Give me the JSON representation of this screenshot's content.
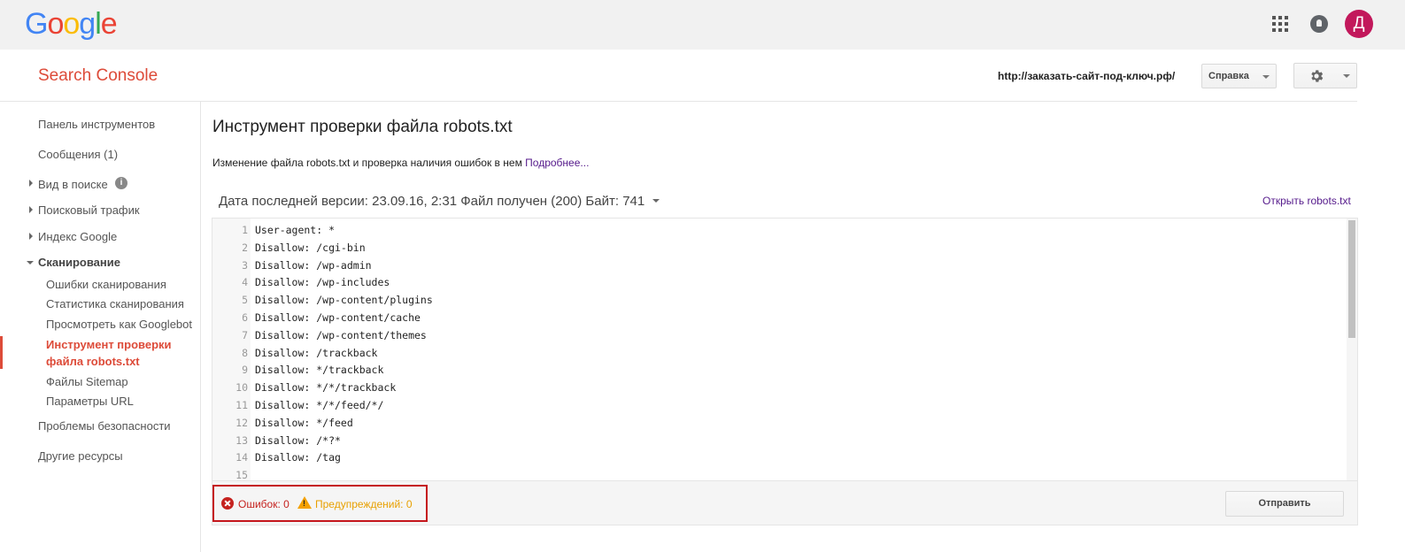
{
  "gbar": {
    "logo_letters": [
      "G",
      "o",
      "o",
      "g",
      "l",
      "e"
    ],
    "logo_colors": [
      "#4285f4",
      "#ea4335",
      "#fbbc05",
      "#4285f4",
      "#34a853",
      "#ea4335"
    ],
    "avatar_letter": "Д",
    "icons": [
      "apps-grid-icon",
      "notifications-bell-icon"
    ]
  },
  "header": {
    "app_title": "Search Console",
    "site_url": "http://заказать-сайт-под-ключ.рф/",
    "help_label": "Справка",
    "settings_icon": "gear-icon"
  },
  "sidebar": {
    "dashboard": "Панель инструментов",
    "messages": "Сообщения (1)",
    "search_appearance": "Вид в поиске",
    "search_traffic": "Поисковый трафик",
    "google_index": "Индекс Google",
    "crawl": "Сканирование",
    "crawl_items": {
      "errors": "Ошибки сканирования",
      "stats": "Статистика сканирования",
      "fetch": "Просмотреть как Googlebot",
      "robots_line1": "Инструмент проверки",
      "robots_line2": "файла robots.txt",
      "sitemaps": "Файлы Sitemap",
      "url_params": "Параметры URL"
    },
    "security": "Проблемы безопасности",
    "other": "Другие ресурсы",
    "active_color": "#dd4b39"
  },
  "main": {
    "title": "Инструмент проверки файла robots.txt",
    "description": "Изменение файла robots.txt и проверка наличия ошибок в нем",
    "more_link": "Подробнее...",
    "version_info": "Дата последней версии: 23.09.16, 2:31 Файл получен (200) Байт: 741",
    "open_link": "Открыть robots.txt",
    "lines": [
      {
        "n": "1",
        "text": "User-agent: *"
      },
      {
        "n": "2",
        "text": "Disallow: /cgi-bin"
      },
      {
        "n": "3",
        "text": "Disallow: /wp-admin"
      },
      {
        "n": "4",
        "text": "Disallow: /wp-includes"
      },
      {
        "n": "5",
        "text": "Disallow: /wp-content/plugins"
      },
      {
        "n": "6",
        "text": "Disallow: /wp-content/cache"
      },
      {
        "n": "7",
        "text": "Disallow: /wp-content/themes"
      },
      {
        "n": "8",
        "text": "Disallow: /trackback"
      },
      {
        "n": "9",
        "text": "Disallow: */trackback"
      },
      {
        "n": "10",
        "text": "Disallow: */*/trackback"
      },
      {
        "n": "11",
        "text": "Disallow: */*/feed/*/"
      },
      {
        "n": "12",
        "text": "Disallow: */feed"
      },
      {
        "n": "13",
        "text": "Disallow: /*?*"
      },
      {
        "n": "14",
        "text": "Disallow: /tag"
      },
      {
        "n": "15",
        "text": ""
      }
    ],
    "errors_label": "Ошибок: 0",
    "warnings_label": "Предупреждений: 0",
    "error_color": "#c5221f",
    "warning_color": "#e8a000",
    "submit_label": "Отправить"
  }
}
